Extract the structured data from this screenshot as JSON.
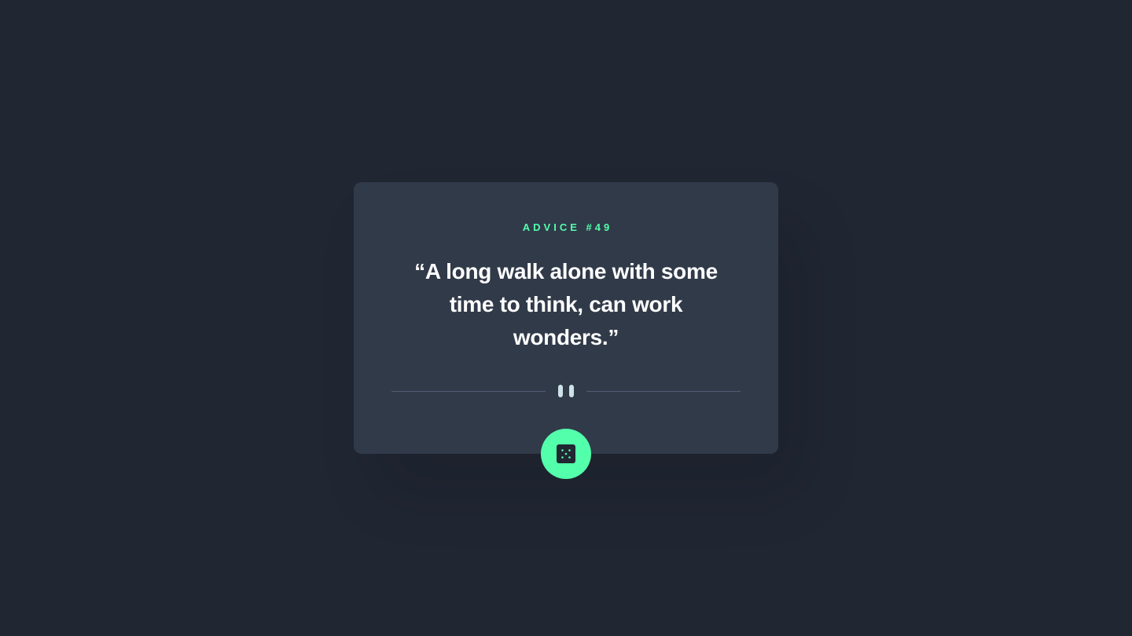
{
  "advice": {
    "id_label": "Advice #49",
    "quote": "“A long walk alone with some time to think, can work wonders.”"
  },
  "icons": {
    "divider": "pause-icon",
    "button": "dice-icon"
  },
  "colors": {
    "background": "#202632",
    "card": "#313a49",
    "accent": "#53ffab",
    "text": "#ffffff",
    "divider_line": "#4f5d74",
    "divider_icon": "#cee3e9"
  }
}
